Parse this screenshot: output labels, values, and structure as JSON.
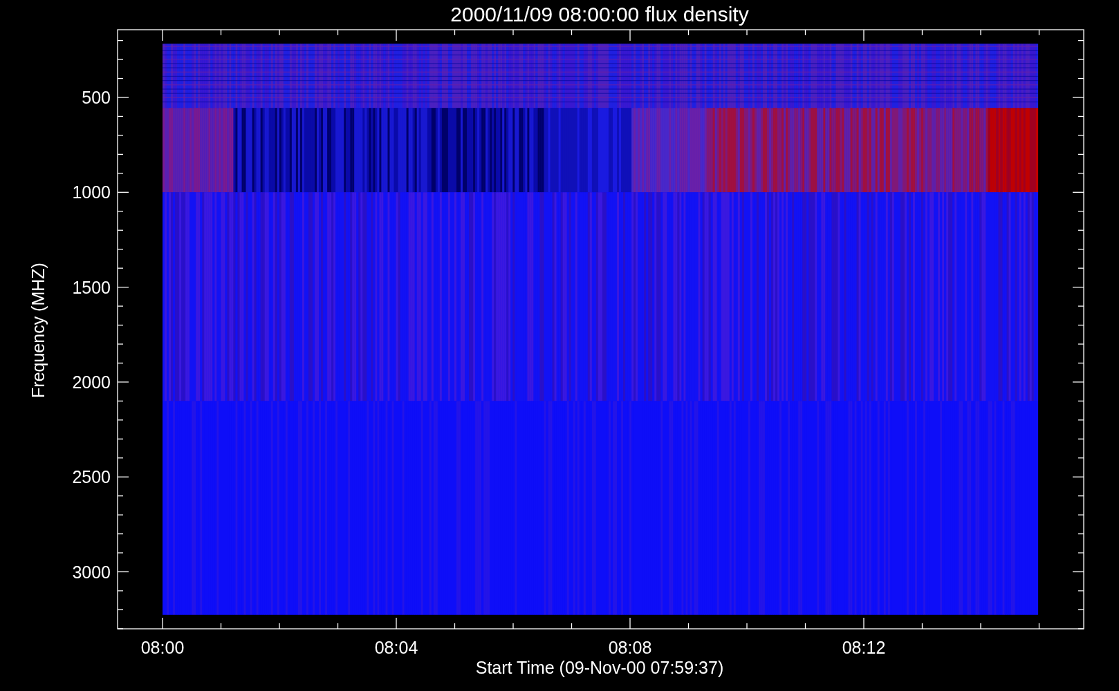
{
  "title": "2000/11/09 08:00:00 flux density",
  "y_axis": {
    "label": "Frequency (MHZ)",
    "ticks": [
      "500",
      "1000",
      "1500",
      "2000",
      "2500",
      "3000"
    ]
  },
  "x_axis": {
    "label": "Start Time (09-Nov-00 07:59:37)",
    "ticks": [
      "08:00",
      "08:04",
      "08:08",
      "08:12"
    ]
  }
}
